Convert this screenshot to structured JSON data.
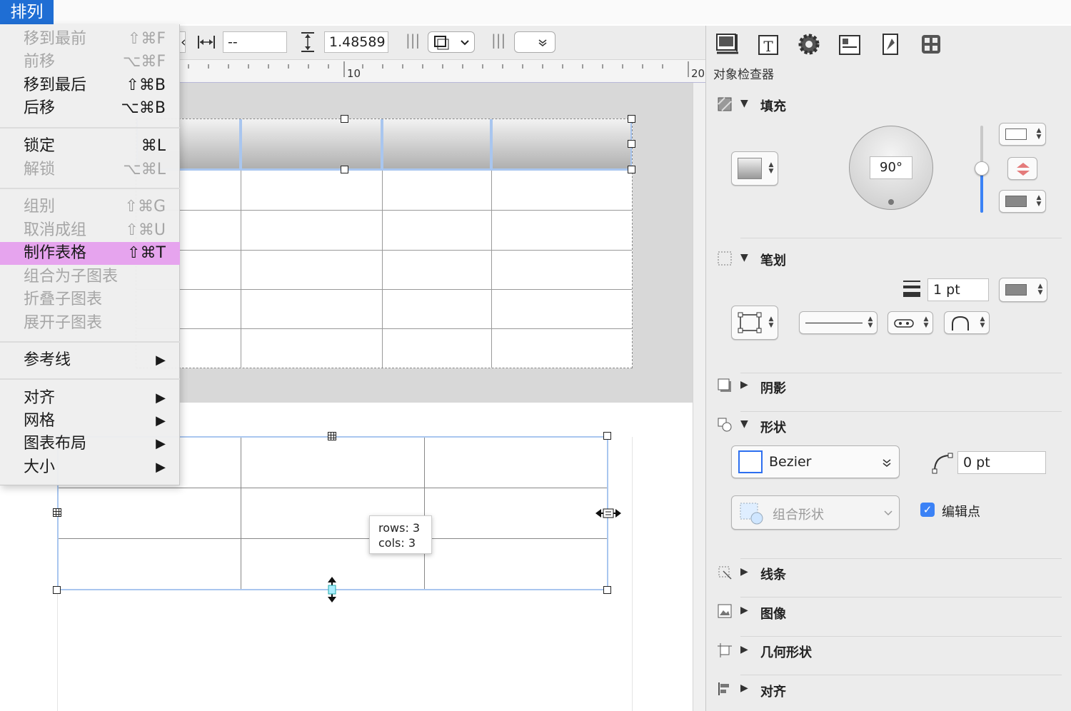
{
  "menubar": {
    "title": "排列"
  },
  "toolbar": {
    "width_value": "--",
    "height_value": "1.48589",
    "left_stub": "‹",
    "sep1": "|||",
    "sep2": "|||"
  },
  "ruler": {
    "label_10": "10",
    "label_20": "20"
  },
  "menu": {
    "items": [
      {
        "label": "移到最前",
        "shortcut": "⇧⌘F",
        "state": "disabled"
      },
      {
        "label": "前移",
        "shortcut": "⌥⌘F",
        "state": "disabled"
      },
      {
        "label": "移到最后",
        "shortcut": "⇧⌘B",
        "state": "enabled"
      },
      {
        "label": "后移",
        "shortcut": "⌥⌘B",
        "state": "enabled"
      },
      {
        "label": "锁定",
        "shortcut": "⌘L",
        "state": "enabled"
      },
      {
        "label": "解锁",
        "shortcut": "⌥⌘L",
        "state": "disabled"
      },
      {
        "label": "组别",
        "shortcut": "⇧⌘G",
        "state": "disabled"
      },
      {
        "label": "取消成组",
        "shortcut": "⇧⌘U",
        "state": "disabled"
      },
      {
        "label": "制作表格",
        "shortcut": "⇧⌘T",
        "state": "highlighted"
      },
      {
        "label": "组合为子图表",
        "shortcut": "",
        "state": "disabled"
      },
      {
        "label": "折叠子图表",
        "shortcut": "",
        "state": "disabled"
      },
      {
        "label": "展开子图表",
        "shortcut": "",
        "state": "disabled"
      },
      {
        "label": "参考线",
        "submenu": "▶",
        "state": "enabled"
      },
      {
        "label": "对齐",
        "submenu": "▶",
        "state": "enabled"
      },
      {
        "label": "网格",
        "submenu": "▶",
        "state": "enabled"
      },
      {
        "label": "图表布局",
        "submenu": "▶",
        "state": "enabled"
      },
      {
        "label": "大小",
        "submenu": "▶",
        "state": "enabled"
      }
    ],
    "highlight_color": "#e6a4ee"
  },
  "tooltip": {
    "rows": "rows: 3",
    "cols": "cols: 3"
  },
  "inspector": {
    "title": "对象检查器",
    "tabs": [
      "canvas-icon",
      "text-icon",
      "gear-icon",
      "layout-icon",
      "properties-icon",
      "grid-icon"
    ],
    "fill": {
      "label": "填充",
      "angle": "90°"
    },
    "stroke": {
      "label": "笔划",
      "width": "1 pt"
    },
    "shadow": {
      "label": "阴影"
    },
    "shape": {
      "label": "形状",
      "type": "Bezier",
      "corner_radius": "0 pt",
      "combine_label": "组合形状",
      "edit_points_label": "编辑点",
      "edit_points_checked": true
    },
    "lines": {
      "label": "线条"
    },
    "image": {
      "label": "图像"
    },
    "geometry": {
      "label": "几何形状"
    },
    "align": {
      "label": "对齐"
    },
    "accent_color": "#3b82f6"
  }
}
